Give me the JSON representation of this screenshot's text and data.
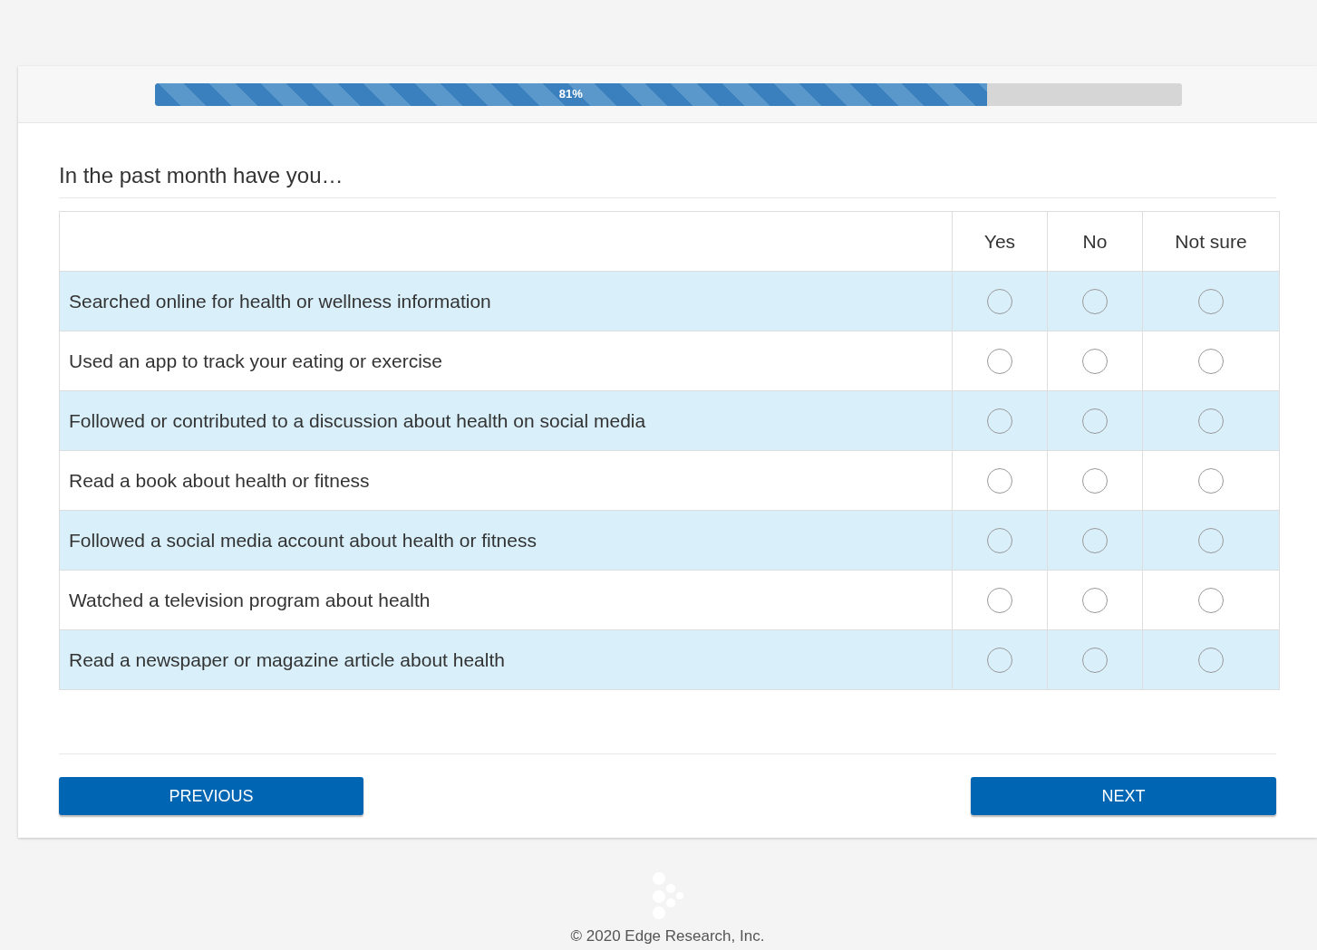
{
  "progress": {
    "level": 0.81,
    "label": "81%"
  },
  "question": "In the past month have you…",
  "columns": [
    "Yes",
    "No",
    "Not sure"
  ],
  "rows": [
    {
      "label": "Searched online for health or wellness information",
      "choices": [
        {
          "selected": false
        },
        {
          "selected": false
        },
        {
          "selected": false
        }
      ]
    },
    {
      "label": "Used an app to track your eating or exercise",
      "choices": [
        {
          "selected": false
        },
        {
          "selected": false
        },
        {
          "selected": false
        }
      ]
    },
    {
      "label": "Followed or contributed to a discussion about health on social media",
      "choices": [
        {
          "selected": false
        },
        {
          "selected": false
        },
        {
          "selected": false
        }
      ]
    },
    {
      "label": "Read a book about health or fitness",
      "choices": [
        {
          "selected": false
        },
        {
          "selected": false
        },
        {
          "selected": false
        }
      ]
    },
    {
      "label": "Followed a social media account about health or fitness",
      "choices": [
        {
          "selected": false
        },
        {
          "selected": false
        },
        {
          "selected": false
        }
      ]
    },
    {
      "label": "Watched a television program about health",
      "choices": [
        {
          "selected": false
        },
        {
          "selected": false
        },
        {
          "selected": false
        }
      ]
    },
    {
      "label": "Read a newspaper or magazine article about health",
      "choices": [
        {
          "selected": false
        },
        {
          "selected": false
        },
        {
          "selected": false
        }
      ]
    }
  ],
  "buttons": {
    "previous": "PREVIOUS",
    "next": "NEXT"
  },
  "footer": "© 2020 Edge Research, Inc."
}
